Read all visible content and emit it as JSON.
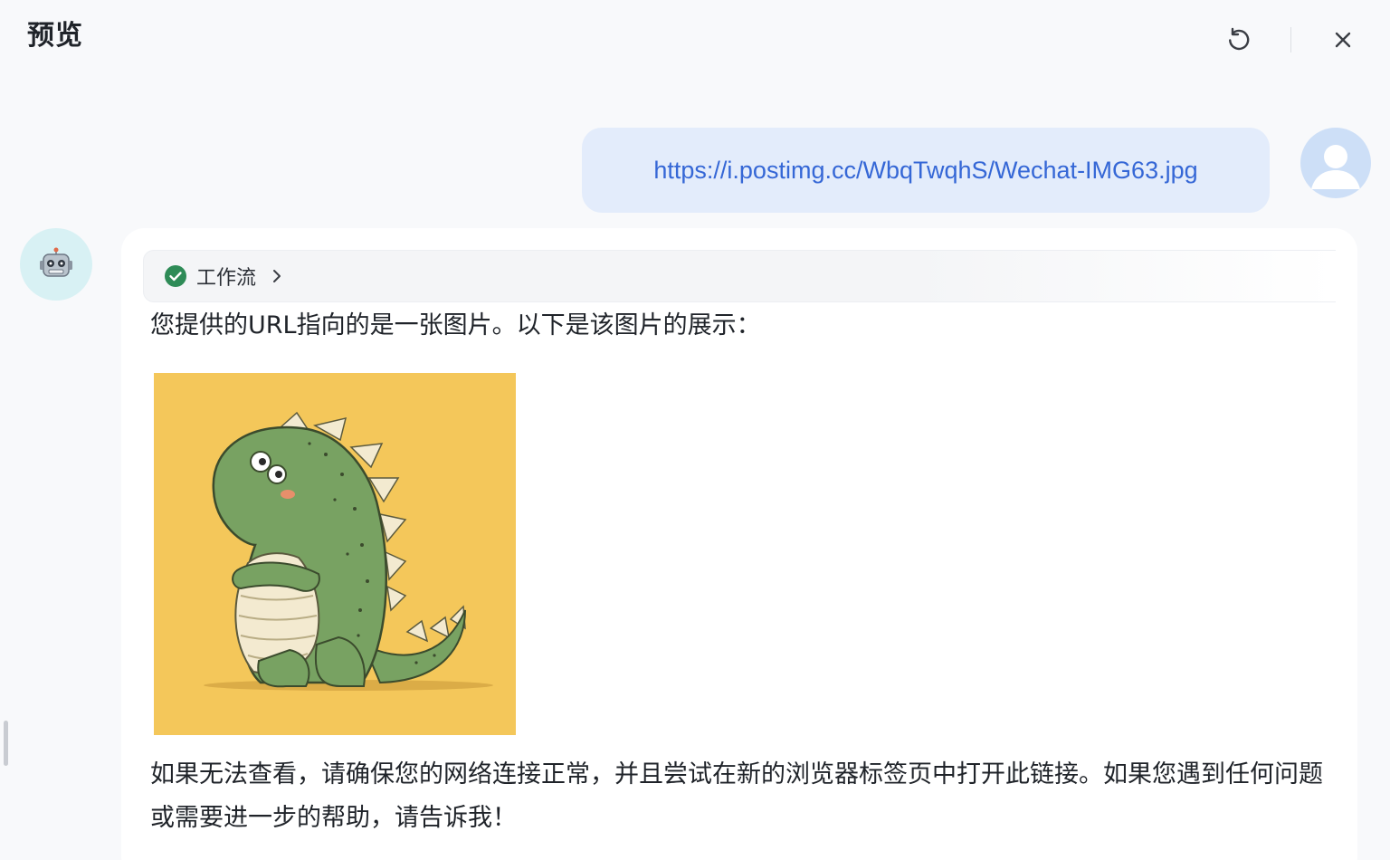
{
  "header": {
    "title": "预览",
    "refresh_icon": "refresh-icon",
    "close_icon": "close-icon"
  },
  "user_message": {
    "link_text": "https://i.postimg.cc/WbqTwqhS/Wechat-IMG63.jpg",
    "avatar_icon": "user-avatar-icon"
  },
  "bot_message": {
    "avatar_icon": "robot-icon",
    "workflow_label": "工作流",
    "workflow_status": "check-circle-icon",
    "intro_text": "您提供的URL指向的是一张图片。以下是该图片的展示：",
    "image_icon": "dinosaur-illustration",
    "outro_text": "如果无法查看，请确保您的网络连接正常，并且尝试在新的浏览器标签页中打开此链接。如果您遇到任何问题或需要进一步的帮助，请告诉我！"
  },
  "colors": {
    "accent": "#3567d6",
    "user_bubble": "#e3ecfb",
    "success": "#2e8b57",
    "image_background": "#f4c75a"
  }
}
